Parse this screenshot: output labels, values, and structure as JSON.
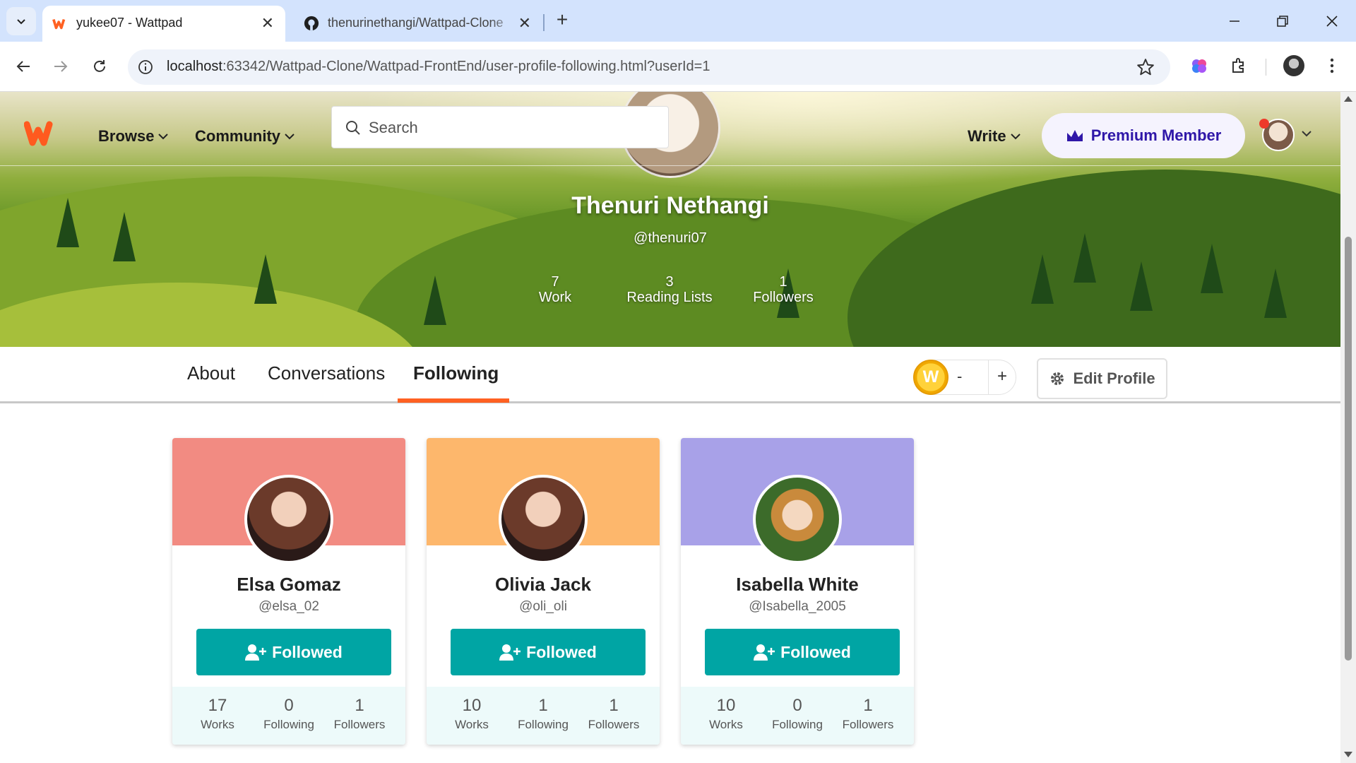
{
  "browser": {
    "tabs": [
      {
        "title": "yukee07 - Wattpad",
        "active": true
      },
      {
        "title": "thenurinethangi/Wattpad-Clone",
        "active": false
      }
    ],
    "url_host": "localhost",
    "url_rest": ":63342/Wattpad-Clone/Wattpad-FrontEnd/user-profile-following.html?userId=1"
  },
  "navbar": {
    "browse": "Browse",
    "community": "Community",
    "search_placeholder": "Search",
    "write": "Write",
    "premium": "Premium Member"
  },
  "profile": {
    "name": "Thenuri Nethangi",
    "handle": "@thenuri07",
    "stats": [
      {
        "value": "7",
        "label": "Work"
      },
      {
        "value": "3",
        "label": "Reading Lists"
      },
      {
        "value": "1",
        "label": "Followers"
      }
    ]
  },
  "tabs": {
    "about": "About",
    "conversations": "Conversations",
    "following": "Following"
  },
  "coins": {
    "minus": "-",
    "plus": "+",
    "coin_letter": "W"
  },
  "edit_profile": "Edit Profile",
  "following": [
    {
      "name": "Elsa Gomaz",
      "handle": "@elsa_02",
      "button": "Followed",
      "cover_color": "#f28b82",
      "stats": [
        {
          "value": "17",
          "label": "Works"
        },
        {
          "value": "0",
          "label": "Following"
        },
        {
          "value": "1",
          "label": "Followers"
        }
      ]
    },
    {
      "name": "Olivia Jack",
      "handle": "@oli_oli",
      "button": "Followed",
      "cover_color": "#fdb76c",
      "stats": [
        {
          "value": "10",
          "label": "Works"
        },
        {
          "value": "1",
          "label": "Following"
        },
        {
          "value": "1",
          "label": "Followers"
        }
      ]
    },
    {
      "name": "Isabella White",
      "handle": "@Isabella_2005",
      "button": "Followed",
      "cover_color": "#a8a1e8",
      "stats": [
        {
          "value": "10",
          "label": "Works"
        },
        {
          "value": "0",
          "label": "Following"
        },
        {
          "value": "1",
          "label": "Followers"
        }
      ]
    }
  ],
  "colors": {
    "accent": "#ff6122",
    "teal": "#00a5a4",
    "premium": "#2f17a8"
  }
}
